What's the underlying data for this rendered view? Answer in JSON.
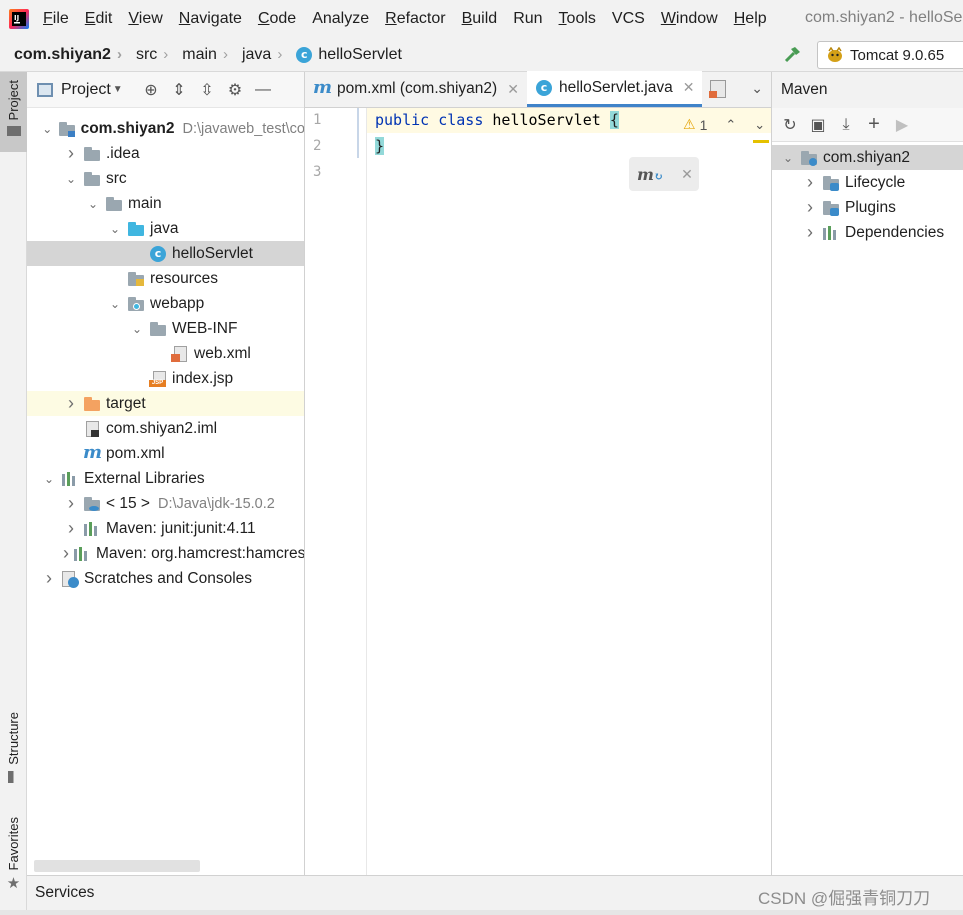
{
  "menubar": {
    "items": [
      {
        "mn": "F",
        "rest": "ile"
      },
      {
        "mn": "E",
        "rest": "dit"
      },
      {
        "mn": "V",
        "rest": "iew"
      },
      {
        "mn": "N",
        "rest": "avigate"
      },
      {
        "mn": "C",
        "rest": "ode"
      },
      {
        "mn": "",
        "rest": "Analyze"
      },
      {
        "mn": "R",
        "rest": "efactor"
      },
      {
        "mn": "B",
        "rest": "uild"
      },
      {
        "mn": "",
        "rest": "Run"
      },
      {
        "mn": "T",
        "rest": "ools"
      },
      {
        "mn": "",
        "rest": "VCS"
      },
      {
        "mn": "W",
        "rest": "indow"
      },
      {
        "mn": "H",
        "rest": "elp"
      }
    ],
    "window_title": "com.shiyan2 - helloSe"
  },
  "breadcrumb": [
    "com.shiyan2",
    "src",
    "main",
    "java",
    "helloServlet"
  ],
  "run_config": "Tomcat 9.0.65",
  "left_stripe": {
    "project": "Project",
    "structure": "Structure",
    "favorites": "Favorites"
  },
  "project_panel": {
    "title": "Project",
    "tree": [
      {
        "label": "com.shiyan2",
        "extra": "D:\\javaweb_test\\co",
        "level": 0,
        "arrow": "down",
        "icon": "module",
        "bold": true
      },
      {
        "label": ".idea",
        "level": 1,
        "arrow": "right",
        "icon": "folder"
      },
      {
        "label": "src",
        "level": 1,
        "arrow": "down",
        "icon": "folder"
      },
      {
        "label": "main",
        "level": 2,
        "arrow": "down",
        "icon": "folder"
      },
      {
        "label": "java",
        "level": 3,
        "arrow": "down",
        "icon": "folder-blue"
      },
      {
        "label": "helloServlet",
        "level": 4,
        "arrow": "",
        "icon": "class",
        "selected": true
      },
      {
        "label": "resources",
        "level": 3,
        "arrow": "",
        "icon": "folder-res"
      },
      {
        "label": "webapp",
        "level": 3,
        "arrow": "down",
        "icon": "folder-web"
      },
      {
        "label": "WEB-INF",
        "level": 4,
        "arrow": "down",
        "icon": "folder"
      },
      {
        "label": "web.xml",
        "level": 5,
        "arrow": "",
        "icon": "xml"
      },
      {
        "label": "index.jsp",
        "level": 4,
        "arrow": "",
        "icon": "jsp"
      },
      {
        "label": "target",
        "level": 1,
        "arrow": "right",
        "icon": "folder-orange",
        "excluded": true
      },
      {
        "label": "com.shiyan2.iml",
        "level": 1,
        "arrow": "",
        "icon": "iml"
      },
      {
        "label": "pom.xml",
        "level": 1,
        "arrow": "",
        "icon": "maven"
      },
      {
        "label": "External Libraries",
        "level": 0,
        "arrow": "down",
        "icon": "libs"
      },
      {
        "label": "< 15 >",
        "extra": "D:\\Java\\jdk-15.0.2",
        "level": 1,
        "arrow": "right",
        "icon": "jdk"
      },
      {
        "label": "Maven: junit:junit:4.11",
        "level": 1,
        "arrow": "right",
        "icon": "lib"
      },
      {
        "label": "Maven: org.hamcrest:hamcrest",
        "level": 1,
        "arrow": "right",
        "icon": "lib"
      },
      {
        "label": "Scratches and Consoles",
        "level": 0,
        "arrow": "right",
        "icon": "scratch"
      }
    ]
  },
  "editor": {
    "tabs": [
      {
        "label": "pom.xml (com.shiyan2)",
        "icon": "maven",
        "active": false
      },
      {
        "label": "helloServlet.java",
        "icon": "class",
        "active": true
      }
    ],
    "line_numbers": [
      "1",
      "2",
      "3"
    ],
    "code": {
      "kw1": "public",
      "kw2": "class",
      "name": "helloServlet",
      "open": "{",
      "close": "}"
    },
    "warning_count": "1"
  },
  "maven": {
    "title": "Maven",
    "tree": [
      {
        "label": "com.shiyan2",
        "arrow": "down",
        "level": 0,
        "selected": true
      },
      {
        "label": "Lifecycle",
        "arrow": "right",
        "level": 1
      },
      {
        "label": "Plugins",
        "arrow": "right",
        "level": 1
      },
      {
        "label": "Dependencies",
        "arrow": "right",
        "level": 1
      }
    ]
  },
  "bottom": {
    "services": "Services"
  },
  "watermark": "CSDN @倔强青铜刀刀",
  "colors": {
    "accent": "#4083c9",
    "selection": "#d5d5d5",
    "keyword": "#0033b3",
    "class_icon": "#3ba4d8"
  }
}
